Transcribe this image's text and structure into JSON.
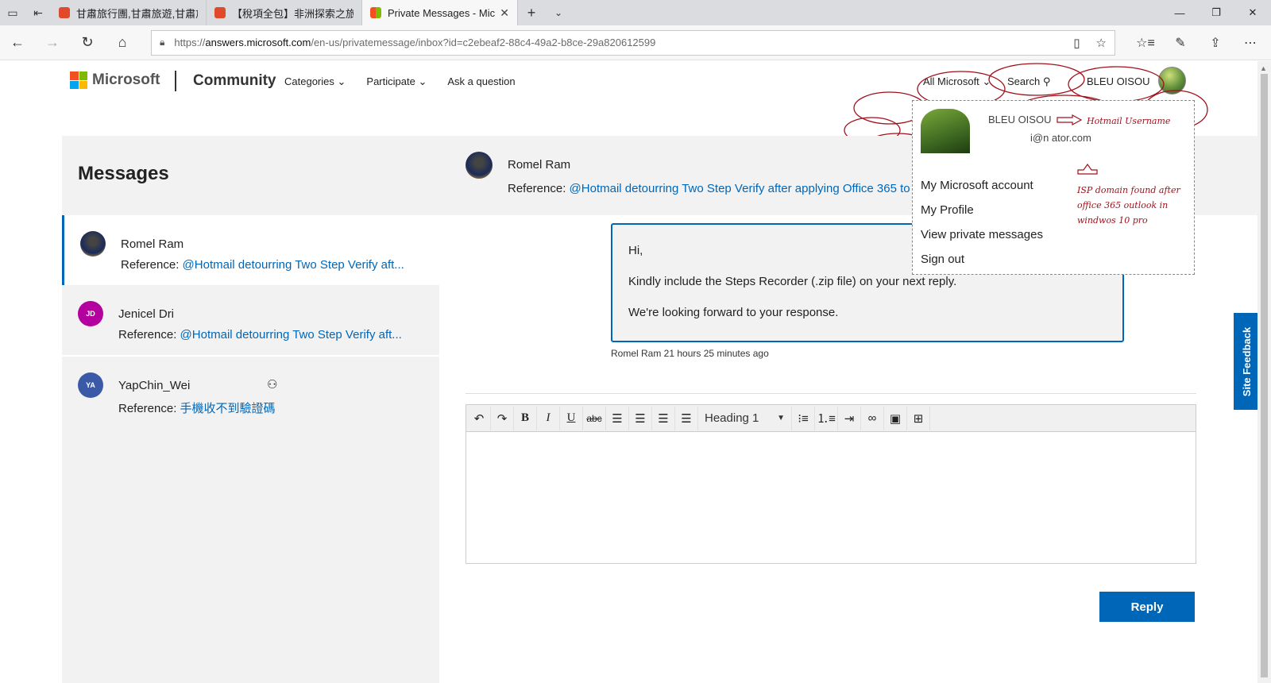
{
  "browser": {
    "tabs": [
      {
        "title": "甘肅旅行團,甘肅旅遊,甘肅旅",
        "fav_color": "#e04a2a"
      },
      {
        "title": "【稅項全包】非洲探索之旅",
        "fav_color": "#e04a2a"
      },
      {
        "title": "Private Messages - Micr",
        "fav_color": "#00a4ef"
      }
    ],
    "url_scheme": "https://",
    "url_host": "answers.microsoft.com",
    "url_rest": "/en-us/privatemessage/inbox?id=c2ebeaf2-88c4-49a2-b8ce-29a820612599"
  },
  "header": {
    "brand": "Microsoft",
    "community": "Community",
    "nav": [
      "Categories",
      "Participate",
      "Ask a question"
    ],
    "all_microsoft": "All Microsoft",
    "search": "Search",
    "user": "BLEU OISOU"
  },
  "sidebar": {
    "title": "Messages",
    "conversations": [
      {
        "name": "Romel Ram",
        "ref_label": "Reference:",
        "ref_link": "@Hotmail detourring Two Step Verify aft...",
        "initials": ""
      },
      {
        "name": "Jenicel Dri",
        "ref_label": "Reference:",
        "ref_link": "@Hotmail detourring Two Step Verify aft...",
        "initials": "JD"
      },
      {
        "name": "YapChin_Wei",
        "ref_label": "Reference:",
        "ref_link": "手機收不到驗證碼",
        "initials": "YA"
      }
    ]
  },
  "thread": {
    "name": "Romel Ram",
    "ref_label": "Reference:",
    "ref_link": "@Hotmail detourring Two Step Verify after applying Office 365 to",
    "message": {
      "line1": "Hi,",
      "line2": "Kindly include the Steps Recorder (.zip file) on your next reply.",
      "line3": "We're looking forward to your response."
    },
    "meta": "Romel Ram 21 hours 25 minutes ago"
  },
  "editor": {
    "heading_select": "Heading 1",
    "reply": "Reply"
  },
  "dropdown": {
    "name": "BLEU OISOU",
    "email": "i@n     ator.com",
    "items": [
      "My Microsoft account",
      "My Profile",
      "View private messages",
      "Sign out"
    ]
  },
  "annotations": {
    "username": "Hotmail Username",
    "isp": "ISP domain found after office 365 outlook in windwos 10 pro"
  },
  "feedback": "Site Feedback"
}
